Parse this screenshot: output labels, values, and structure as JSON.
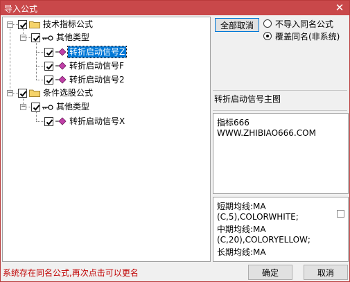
{
  "window": {
    "title": "导入公式",
    "close_glyph": "✕"
  },
  "tree": {
    "root1": {
      "label": "技术指标公式",
      "group": {
        "label": "其他类型",
        "items": [
          "转折启动信号Z",
          "转折启动信号F",
          "转折启动信号2"
        ],
        "selected_index": 0
      }
    },
    "root2": {
      "label": "条件选股公式",
      "group": {
        "label": "其他类型",
        "items": [
          "转折启动信号X"
        ]
      }
    }
  },
  "controls": {
    "cancel_all_label": "全部取消",
    "radio_options": [
      {
        "label": "不导入同名公式",
        "checked": false
      },
      {
        "label": "覆盖同名(非系统)",
        "checked": true
      }
    ]
  },
  "preview": {
    "caption": "转折启动信号主图",
    "description_lines": [
      "指标666",
      "WWW.ZHIBIAO666.COM"
    ],
    "code_lines": [
      "短期均线:MA",
      "(C,5),COLORWHITE;",
      "中期均线:MA",
      "(C,20),COLORYELLOW;",
      "长期均线:MA"
    ]
  },
  "status": {
    "message": "系统存在同名公式,再次点击可以更名"
  },
  "footer": {
    "ok_label": "确定",
    "cancel_label": "取消"
  },
  "colors": {
    "titlebar": "#c9484a",
    "selection": "#0078d7",
    "status_text": "#c00000",
    "folder": "#f5d36a",
    "diamond": "#c03fa8"
  },
  "icons": {
    "folder": "folder-icon",
    "key": "key-icon",
    "formula": "formula-diamond-icon",
    "check": "check-icon",
    "close": "close-icon"
  }
}
